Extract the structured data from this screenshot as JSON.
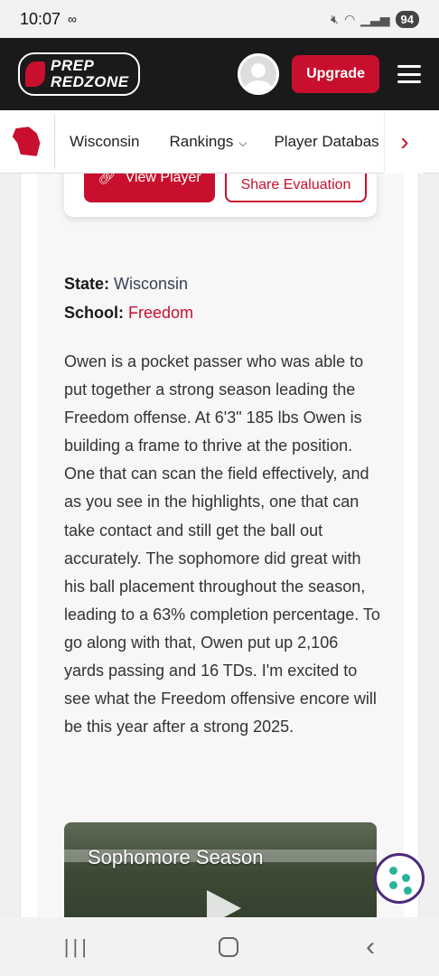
{
  "status_bar": {
    "time": "10:07",
    "battery": "94"
  },
  "topnav": {
    "logo_line1": "PREP",
    "logo_line2": "REDZONE",
    "upgrade_label": "Upgrade"
  },
  "subnav": {
    "state": "Wisconsin",
    "rankings": "Rankings",
    "player_database": "Player Databas"
  },
  "actions": {
    "view_player": "View Player",
    "share_evaluation": "Share Evaluation"
  },
  "player": {
    "state_label": "State:",
    "state_value": "Wisconsin",
    "school_label": "School:",
    "school_value": "Freedom"
  },
  "bio": "Owen is a pocket passer who was able to put together a strong season leading the Freedom offense. At 6'3\" 185 lbs Owen is building a frame to thrive at the position. One that can scan the field effectively, and as you see in the highlights, one that can take contact and still get the ball out accurately. The sophomore did great with his ball placement throughout the season, leading to a 63% completion percentage. To go along with that, Owen put up 2,106 yards passing and 16 TDs. I'm excited to see what the Freedom offensive encore will be this year after a strong 2025.",
  "video": {
    "title": "Sophomore Season"
  },
  "colors": {
    "brand_red": "#c8102e",
    "nav_dark": "#1a1a1a"
  }
}
